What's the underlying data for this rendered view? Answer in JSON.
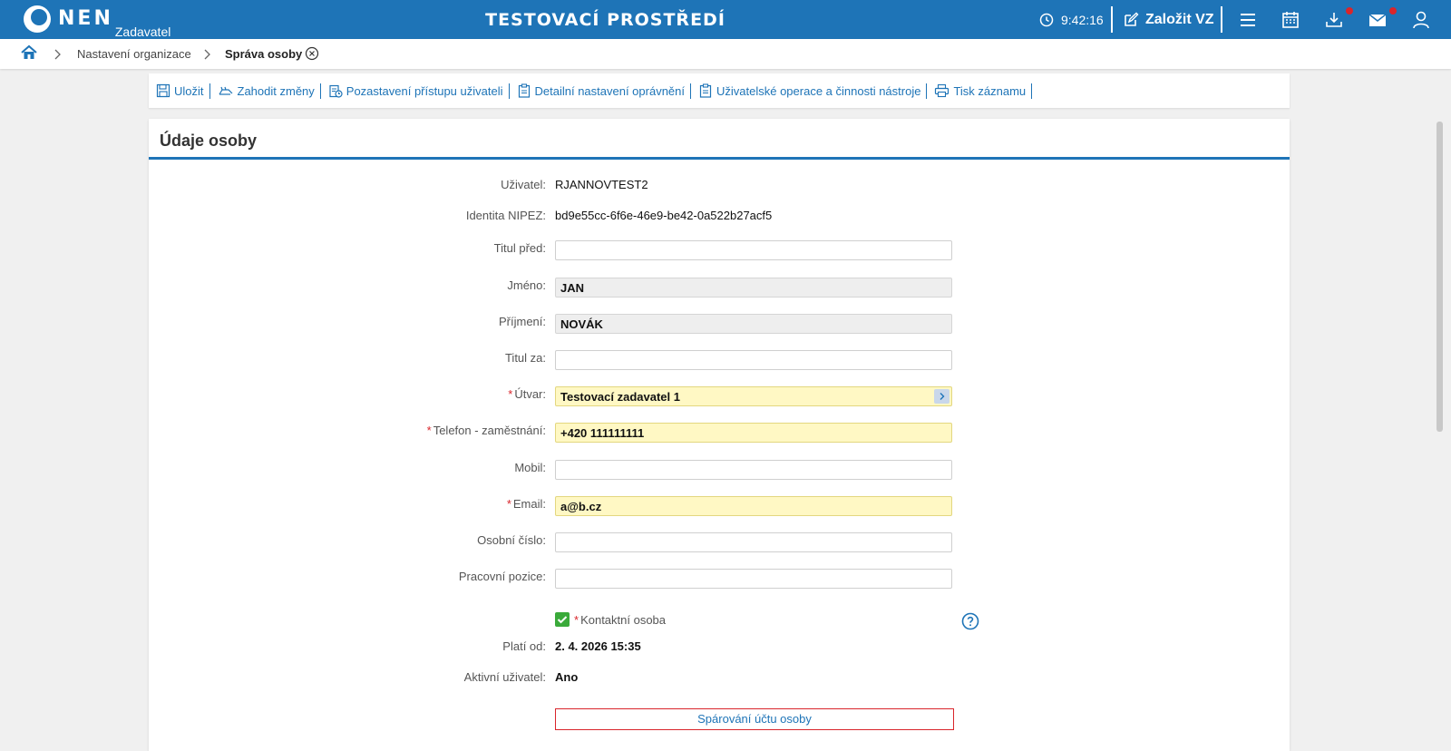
{
  "header": {
    "logo_text": "NEN",
    "logo_sub": "Zadavatel",
    "env_title": "TESTOVACÍ PROSTŘEDÍ",
    "time": "9:42:16",
    "create_label": "Založit VZ",
    "icons": [
      "clock-icon",
      "edit-icon",
      "menu-icon",
      "calendar-icon",
      "download-icon",
      "mail-icon",
      "user-icon"
    ],
    "accent": "#1e74b7",
    "badge_color": "#d9252b"
  },
  "breadcrumb": {
    "items": [
      "Nastavení organizace",
      "Správa osoby"
    ]
  },
  "toolbar": {
    "items": [
      {
        "label": "Uložit",
        "icon": "save-icon"
      },
      {
        "label": "Zahodit změny",
        "icon": "discard-icon"
      },
      {
        "label": "Pozastavení přístupu uživateli",
        "icon": "suspend-icon"
      },
      {
        "label": "Detailní nastavení oprávnění",
        "icon": "clipboard-icon"
      },
      {
        "label": "Uživatelské operace a činnosti nástroje",
        "icon": "clipboard-icon"
      },
      {
        "label": "Tisk záznamu",
        "icon": "print-icon"
      }
    ]
  },
  "panel": {
    "title": "Údaje osoby"
  },
  "form": {
    "user_label": "Uživatel:",
    "user_value": "RJANNOVTEST2",
    "nipez_label": "Identita NIPEZ:",
    "nipez_value": "bd9e55cc-6f6e-46e9-be42-0a522b27acf5",
    "title_before_label": "Titul před:",
    "title_before_value": "",
    "first_name_label": "Jméno:",
    "first_name_value": "JAN",
    "last_name_label": "Příjmení:",
    "last_name_value": "NOVÁK",
    "title_after_label": "Titul za:",
    "title_after_value": "",
    "unit_label": "Útvar:",
    "unit_value": "Testovací zadavatel 1",
    "phone_label": "Telefon - zaměstnání:",
    "phone_value": "+420 111111111",
    "mobile_label": "Mobil:",
    "mobile_value": "",
    "email_label": "Email:",
    "email_value": "a@b.cz",
    "personal_no_label": "Osobní číslo:",
    "personal_no_value": "",
    "position_label": "Pracovní pozice:",
    "position_value": "",
    "contact_label": "Kontaktní osoba",
    "contact_checked": true,
    "valid_from_label": "Platí od:",
    "valid_from_value": "2. 4. 2026 15:35",
    "active_label": "Aktivní uživatel:",
    "active_value": "Ano",
    "required_mark": "*",
    "pair_button": "Spárování účtu osoby"
  }
}
